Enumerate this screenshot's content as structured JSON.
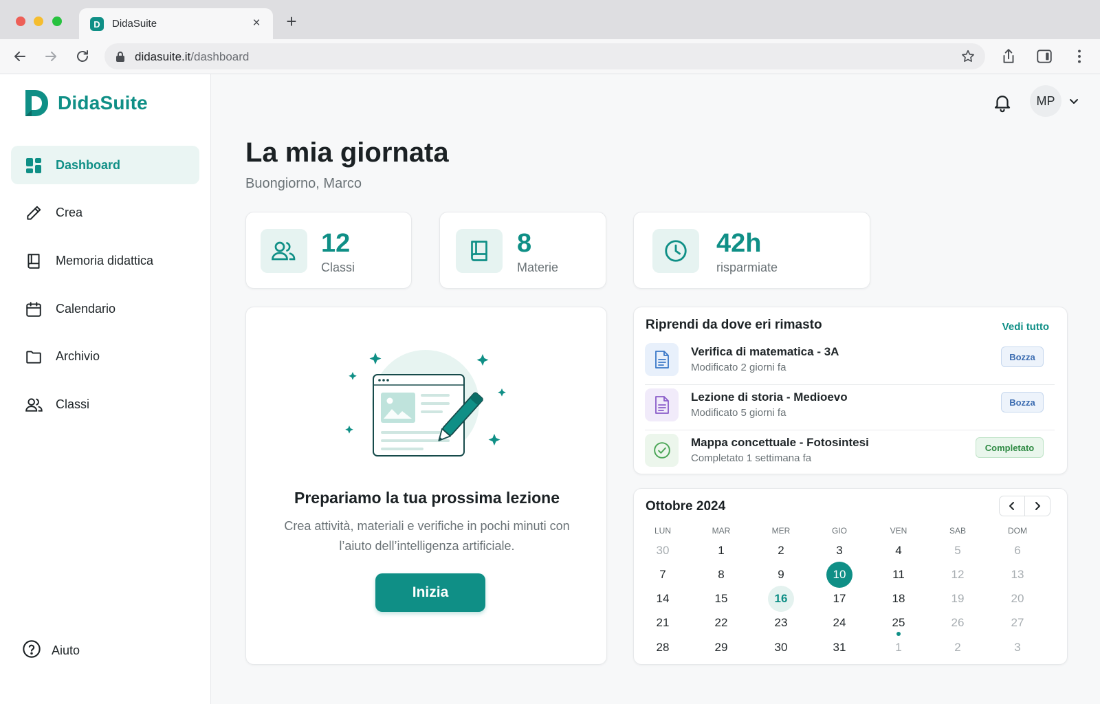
{
  "browser": {
    "tab_title": "DidaSuite",
    "favicon_letter": "D",
    "url_host": "didasuite.it",
    "url_path": "/dashboard"
  },
  "brand": {
    "name": "DidaSuite",
    "accent": "#0f8f86"
  },
  "sidebar": {
    "items": [
      {
        "label": "Dashboard",
        "icon": "grid-icon",
        "active": true
      },
      {
        "label": "Crea",
        "icon": "pencil-icon"
      },
      {
        "label": "Memoria didattica",
        "icon": "book-icon"
      },
      {
        "label": "Calendario",
        "icon": "calendar-icon"
      },
      {
        "label": "Archivio",
        "icon": "folder-icon"
      },
      {
        "label": "Classi",
        "icon": "users-icon"
      }
    ],
    "help_label": "Aiuto"
  },
  "header": {
    "avatar_initials": "MP"
  },
  "page": {
    "title": "La mia giornata",
    "greeting": "Buongiorno, Marco"
  },
  "stats": [
    {
      "value": "12",
      "label": "Classi",
      "icon": "users-icon"
    },
    {
      "value": "8",
      "label": "Materie",
      "icon": "book-icon"
    },
    {
      "value": "42h",
      "label": "risparmiate",
      "icon": "clock-icon"
    }
  ],
  "hero": {
    "title": "Prepariamo la tua prossima lezione",
    "description": "Crea attività, materiali e verifiche in pochi minuti con l’aiuto dell’intelligenza artificiale.",
    "button_label": "Inizia"
  },
  "recent": {
    "title": "Riprendi da dove eri rimasto",
    "see_all": "Vedi tutto",
    "items": [
      {
        "title": "Verifica di matematica - 3A",
        "subtitle": "Modificato 2 giorni fa",
        "badge": "Bozza",
        "status": "draft",
        "icon": "document-icon",
        "color": "#3a78c8"
      },
      {
        "title": "Lezione di storia - Medioevo",
        "subtitle": "Modificato 5 giorni fa",
        "badge": "Bozza",
        "status": "draft",
        "icon": "document-icon",
        "color": "#8a5cc9"
      },
      {
        "title": "Mappa concettuale - Fotosintesi",
        "subtitle": "Completato 1 settimana fa",
        "badge": "Completato",
        "status": "done",
        "icon": "check-circle-icon",
        "color": "#4aa556"
      }
    ]
  },
  "calendar": {
    "month_label": "Ottobre 2024",
    "weekdays": [
      "LUN",
      "MAR",
      "MER",
      "GIO",
      "VEN",
      "SAB",
      "DOM"
    ],
    "weeks": [
      [
        "30",
        "1",
        "2",
        "3",
        "4",
        "5",
        "6"
      ],
      [
        "7",
        "8",
        "9",
        "10",
        "11",
        "12",
        "13"
      ],
      [
        "14",
        "15",
        "16",
        "17",
        "18",
        "19",
        "20"
      ],
      [
        "21",
        "22",
        "23",
        "24",
        "25",
        "26",
        "27"
      ],
      [
        "28",
        "29",
        "30",
        "31",
        "1",
        "2",
        "3"
      ]
    ],
    "selected_day": "10",
    "today_day": "16",
    "event_days": [
      "25"
    ]
  }
}
